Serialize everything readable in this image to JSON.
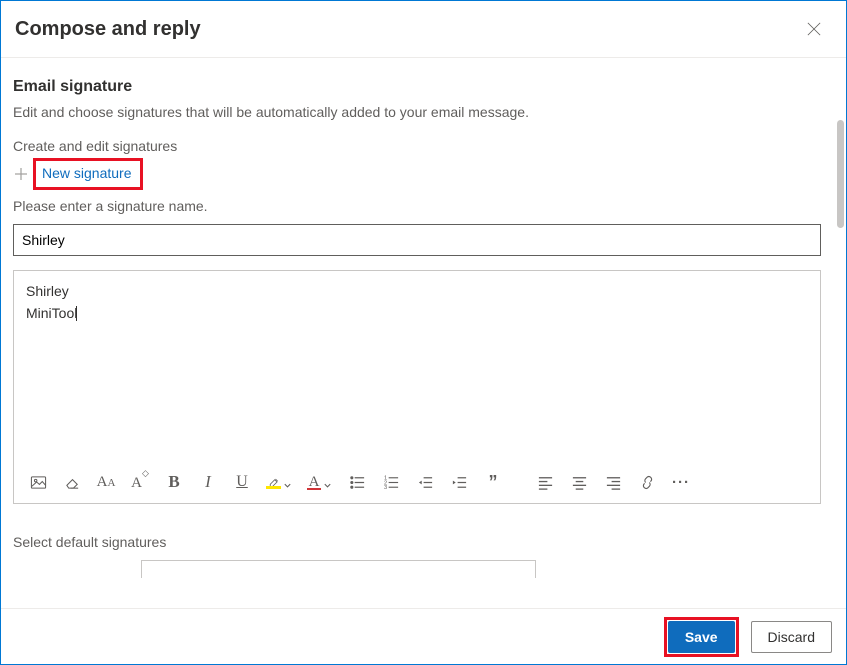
{
  "header": {
    "title": "Compose and reply"
  },
  "signature": {
    "section_title": "Email signature",
    "description": "Edit and choose signatures that will be automatically added to your email message.",
    "create_label": "Create and edit signatures",
    "new_link": "New signature",
    "enter_name_prompt": "Please enter a signature name.",
    "name_value": "Shirley",
    "body_line1": "Shirley",
    "body_line2": "MiniTool"
  },
  "toolbar": {
    "bold_glyph": "B",
    "italic_glyph": "I",
    "underline_glyph": "U",
    "fontsize_small": "A",
    "fontsize_big": "A",
    "fontcolor_glyph": "A",
    "quote_glyph": "”",
    "more_glyph": "···"
  },
  "defaults": {
    "label": "Select default signatures"
  },
  "footer": {
    "save": "Save",
    "discard": "Discard"
  }
}
